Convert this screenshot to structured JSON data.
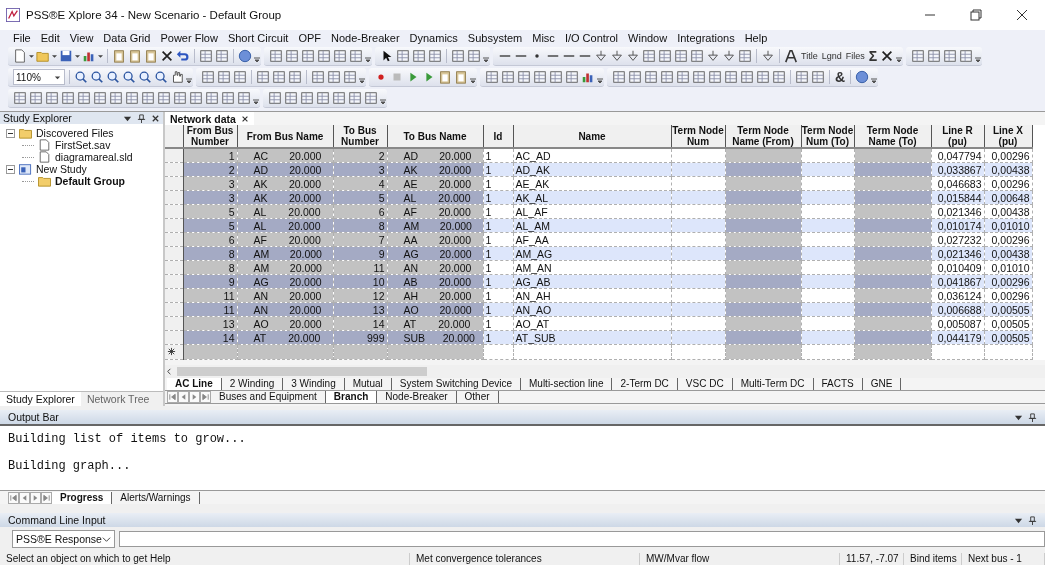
{
  "window": {
    "title": "PSS®E Xplore 34 - New Scenario - Default Group"
  },
  "menu": [
    "File",
    "Edit",
    "View",
    "Data Grid",
    "Power Flow",
    "Short Circuit",
    "OPF",
    "Node-Breaker",
    "Dynamics",
    "Subsystem",
    "Misc",
    "I/O Control",
    "Window",
    "Integrations",
    "Help"
  ],
  "toolbar": {
    "zoom": "110%",
    "texts": [
      "Title",
      "Lgnd",
      "Files",
      "Σ",
      "&"
    ]
  },
  "study_explorer": {
    "title": "Study Explorer",
    "tree": [
      {
        "label": "Discovered Files",
        "kind": "folder",
        "expanded": true,
        "selected": false,
        "children": [
          {
            "label": "FirstSet.sav",
            "kind": "file",
            "selected": false
          },
          {
            "label": "diagramareal.sld",
            "kind": "file",
            "selected": false
          }
        ]
      },
      {
        "label": "New Study",
        "kind": "study",
        "expanded": true,
        "selected": false,
        "children": [
          {
            "label": "Default Group",
            "kind": "folder",
            "selected": true
          }
        ]
      }
    ],
    "tabs": [
      {
        "label": "Study Explorer",
        "selected": true
      },
      {
        "label": "Network Tree",
        "selected": false
      }
    ]
  },
  "document_tab": {
    "label": "Network data"
  },
  "table": {
    "columns": [
      {
        "label": "From Bus Number",
        "readonly": true
      },
      {
        "label": "From Bus Name",
        "readonly": true
      },
      {
        "label": "To Bus Number",
        "readonly": true
      },
      {
        "label": "To Bus Name",
        "readonly": true
      },
      {
        "label": "Id",
        "readonly": false
      },
      {
        "label": "Name",
        "readonly": false
      },
      {
        "label": "Term Node Num",
        "readonly": false
      },
      {
        "label": "Term Node Name (From)",
        "readonly": true
      },
      {
        "label": "Term Node Num (To)",
        "readonly": false
      },
      {
        "label": "Term Node Name (To)",
        "readonly": true
      },
      {
        "label": "Line R (pu)",
        "readonly": false
      },
      {
        "label": "Line X (pu)",
        "readonly": false
      }
    ],
    "rows": [
      [
        "1",
        "AC 20.000",
        "2",
        "AD 20.000",
        "1",
        "AC_AD",
        "",
        "",
        "",
        "",
        "0,047794",
        "0,00296"
      ],
      [
        "2",
        "AD 20.000",
        "3",
        "AK 20.000",
        "1",
        "AD_AK",
        "",
        "",
        "",
        "",
        "0,033867",
        "0,00438"
      ],
      [
        "3",
        "AK 20.000",
        "4",
        "AE 20.000",
        "1",
        "AE_AK",
        "",
        "",
        "",
        "",
        "0,046683",
        "0,00296"
      ],
      [
        "3",
        "AK 20.000",
        "5",
        "AL 20.000",
        "1",
        "AK_AL",
        "",
        "",
        "",
        "",
        "0,015844",
        "0,00648"
      ],
      [
        "5",
        "AL 20.000",
        "6",
        "AF 20.000",
        "1",
        "AL_AF",
        "",
        "",
        "",
        "",
        "0,021346",
        "0,00438"
      ],
      [
        "5",
        "AL 20.000",
        "8",
        "AM 20.000",
        "1",
        "AL_AM",
        "",
        "",
        "",
        "",
        "0,010174",
        "0,01010"
      ],
      [
        "6",
        "AF 20.000",
        "7",
        "AA 20.000",
        "1",
        "AF_AA",
        "",
        "",
        "",
        "",
        "0,027232",
        "0,00296"
      ],
      [
        "8",
        "AM 20.000",
        "9",
        "AG 20.000",
        "1",
        "AM_AG",
        "",
        "",
        "",
        "",
        "0,021346",
        "0,00438"
      ],
      [
        "8",
        "AM 20.000",
        "11",
        "AN 20.000",
        "1",
        "AM_AN",
        "",
        "",
        "",
        "",
        "0,010409",
        "0,01010"
      ],
      [
        "9",
        "AG 20.000",
        "10",
        "AB 20.000",
        "1",
        "AG_AB",
        "",
        "",
        "",
        "",
        "0,041867",
        "0,00296"
      ],
      [
        "11",
        "AN 20.000",
        "12",
        "AH 20.000",
        "1",
        "AN_AH",
        "",
        "",
        "",
        "",
        "0,036124",
        "0,00296"
      ],
      [
        "11",
        "AN 20.000",
        "13",
        "AO 20.000",
        "1",
        "AN_AO",
        "",
        "",
        "",
        "",
        "0,006688",
        "0,00505"
      ],
      [
        "13",
        "AO 20.000",
        "14",
        "AT 20.000",
        "1",
        "AO_AT",
        "",
        "",
        "",
        "",
        "0,005087",
        "0,00505"
      ],
      [
        "14",
        "AT 20.000",
        "999",
        "SUB 20.000",
        "1",
        "AT_SUB",
        "",
        "",
        "",
        "",
        "0,044179",
        "0,00505"
      ]
    ]
  },
  "sheet_tabs": [
    {
      "label": "AC Line",
      "selected": true
    },
    {
      "label": "2 Winding",
      "selected": false
    },
    {
      "label": "3 Winding",
      "selected": false
    },
    {
      "label": "Mutual",
      "selected": false
    },
    {
      "label": "System Switching Device",
      "selected": false
    },
    {
      "label": "Multi-section line",
      "selected": false
    },
    {
      "label": "2-Term DC",
      "selected": false
    },
    {
      "label": "VSC DC",
      "selected": false
    },
    {
      "label": "Multi-Term DC",
      "selected": false
    },
    {
      "label": "FACTS",
      "selected": false
    },
    {
      "label": "GNE",
      "selected": false
    }
  ],
  "category_tabs": [
    {
      "label": "Buses and Equipment",
      "selected": false
    },
    {
      "label": "Branch",
      "selected": true
    },
    {
      "label": "Node-Breaker",
      "selected": false
    },
    {
      "label": "Other",
      "selected": false
    }
  ],
  "output_bar": {
    "title": "Output Bar",
    "lines": [
      "Building list of items to grow...",
      "Building graph..."
    ],
    "tabs": [
      {
        "label": "Progress",
        "selected": true
      },
      {
        "label": "Alerts/Warnings",
        "selected": false
      }
    ]
  },
  "command_line": {
    "title": "Command Line Input",
    "mode": "PSS®E Response"
  },
  "status_bar": [
    "Select an object on which to get Help",
    "Met convergence tolerances",
    "MW/Mvar flow",
    "11.57, -7.07",
    "Bind items",
    "Next bus - 1"
  ]
}
